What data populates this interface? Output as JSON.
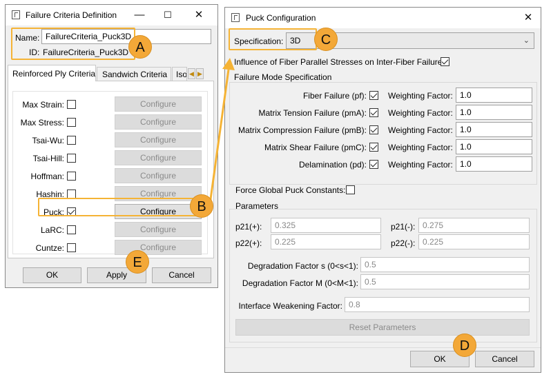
{
  "failure_window": {
    "title": "Failure Criteria Definition",
    "name_label": "Name:",
    "name_value": "FailureCriteria_Puck3D",
    "id_label": "ID:",
    "id_value": "FailureCriteria_Puck3D",
    "tabs": [
      "Reinforced Ply Criteria",
      "Sandwich Criteria",
      "Iso"
    ],
    "criteria": [
      {
        "label": "Max Strain:",
        "checked": false,
        "button": "Configure",
        "enabled": false
      },
      {
        "label": "Max Stress:",
        "checked": false,
        "button": "Configure",
        "enabled": false
      },
      {
        "label": "Tsai-Wu:",
        "checked": false,
        "button": "Configure",
        "enabled": false
      },
      {
        "label": "Tsai-Hill:",
        "checked": false,
        "button": "Configure",
        "enabled": false
      },
      {
        "label": "Hoffman:",
        "checked": false,
        "button": "Configure",
        "enabled": false
      },
      {
        "label": "Hashin:",
        "checked": false,
        "button": "Configure",
        "enabled": false
      },
      {
        "label": "Puck:",
        "checked": true,
        "button": "Configure",
        "enabled": true
      },
      {
        "label": "LaRC:",
        "checked": false,
        "button": "Configure",
        "enabled": false
      },
      {
        "label": "Cuntze:",
        "checked": false,
        "button": "Configure",
        "enabled": false
      }
    ],
    "ok": "OK",
    "apply": "Apply",
    "cancel": "Cancel"
  },
  "puck_window": {
    "title": "Puck Configuration",
    "spec_label": "Specification:",
    "spec_value": "3D",
    "influence_label": "Influence of Fiber Parallel Stresses on Inter-Fiber Failure:",
    "influence_checked": true,
    "failure_mode_title": "Failure Mode Specification",
    "weighting_label": "Weighting Factor:",
    "modes": [
      {
        "label": "Fiber Failure (pf):",
        "checked": true,
        "weight": "1.0"
      },
      {
        "label": "Matrix Tension Failure (pmA):",
        "checked": true,
        "weight": "1.0"
      },
      {
        "label": "Matrix Compression Failure (pmB):",
        "checked": true,
        "weight": "1.0"
      },
      {
        "label": "Matrix Shear Failure (pmC):",
        "checked": true,
        "weight": "1.0"
      },
      {
        "label": "Delamination (pd):",
        "checked": true,
        "weight": "1.0"
      }
    ],
    "force_global_label": "Force Global Puck Constants:",
    "force_global_checked": false,
    "parameters_title": "Parameters",
    "p21_plus_label": "p21(+):",
    "p21_plus": "0.325",
    "p21_minus_label": "p21(-):",
    "p21_minus": "0.275",
    "p22_plus_label": "p22(+):",
    "p22_plus": "0.225",
    "p22_minus_label": "p22(-):",
    "p22_minus": "0.225",
    "deg_s_label": "Degradation Factor s (0<s<1):",
    "deg_s": "0.5",
    "deg_m_label": "Degradation Factor M (0<M<1):",
    "deg_m": "0.5",
    "iwf_label": "Interface Weakening Factor:",
    "iwf": "0.8",
    "reset": "Reset Parameters",
    "ok": "OK",
    "cancel": "Cancel"
  },
  "annotations": {
    "a": "A",
    "b": "B",
    "c": "C",
    "d": "D",
    "e": "E"
  },
  "colors": {
    "callout": "#f5b335",
    "badge": "#f3a838"
  }
}
